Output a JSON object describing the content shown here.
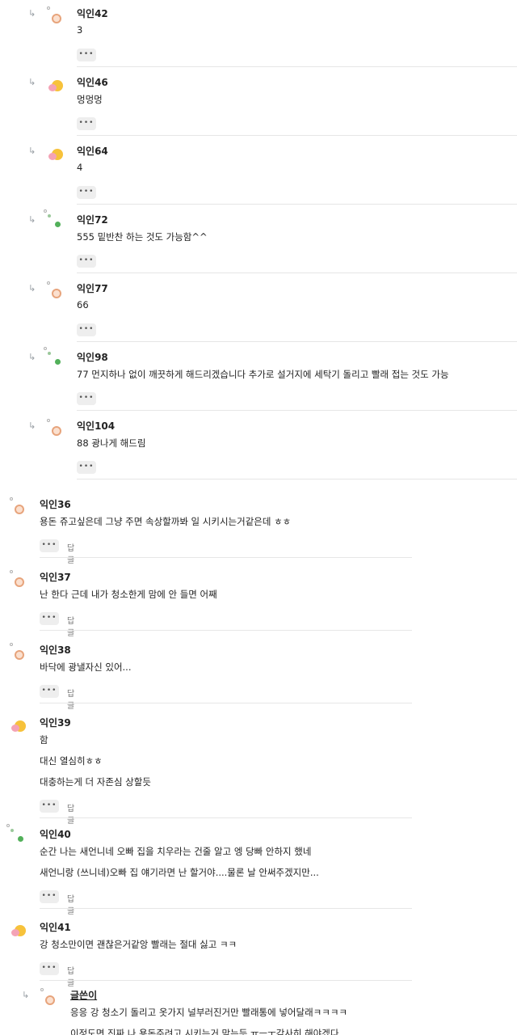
{
  "ui": {
    "more_label": "•••",
    "reply_label": "답글",
    "reply_arrow": "↳"
  },
  "comments": [
    {
      "kind": "reply",
      "avatar": "orange-ring-avatar",
      "name": "익인42",
      "lines": [
        "3"
      ],
      "has_reply_btn": false
    },
    {
      "kind": "reply",
      "avatar": "yellow-pink-avatar",
      "name": "익인46",
      "lines": [
        "멍멍멍"
      ],
      "has_reply_btn": false
    },
    {
      "kind": "reply",
      "avatar": "yellow-pink-avatar",
      "name": "익인64",
      "lines": [
        "4"
      ],
      "has_reply_btn": false
    },
    {
      "kind": "reply",
      "avatar": "green-dots-avatar",
      "name": "익인72",
      "lines": [
        "555 밑반찬 하는 것도 가능함^^"
      ],
      "has_reply_btn": false
    },
    {
      "kind": "reply",
      "avatar": "orange-ring-avatar",
      "name": "익인77",
      "lines": [
        "66"
      ],
      "has_reply_btn": false
    },
    {
      "kind": "reply",
      "avatar": "green-dots-avatar",
      "name": "익인98",
      "lines": [
        "77 먼지하나 없이 깨끗하게 해드리겠습니다 추가로 설거지에 세탁기 돌리고 빨래 접는 것도 가능"
      ],
      "has_reply_btn": false
    },
    {
      "kind": "reply",
      "avatar": "orange-ring-avatar",
      "name": "익인104",
      "lines": [
        "88 광나게 해드림"
      ],
      "has_reply_btn": false
    },
    {
      "kind": "top",
      "avatar": "orange-ring-avatar",
      "name": "익인36",
      "lines": [
        "용돈 쥬고싶은데 그냥 주면 속상할까봐 일 시키시는거같은데 ㅎㅎ"
      ],
      "has_reply_btn": true
    },
    {
      "kind": "top",
      "avatar": "orange-ring-avatar",
      "name": "익인37",
      "lines": [
        "난 한다 근데 내가 청소한게 맘에 안 들면 어째"
      ],
      "has_reply_btn": true
    },
    {
      "kind": "top",
      "avatar": "orange-ring-avatar",
      "name": "익인38",
      "lines": [
        "바닥에 광낼자신 있어..."
      ],
      "has_reply_btn": true
    },
    {
      "kind": "top",
      "avatar": "yellow-pink-avatar",
      "name": "익인39",
      "lines": [
        "함",
        "대신 열심히ㅎㅎ",
        "대충하는게 더 자존심 상할듯"
      ],
      "has_reply_btn": true
    },
    {
      "kind": "top",
      "avatar": "green-dots-avatar",
      "name": "익인40",
      "lines": [
        "순간 나는 새언니네 오빠 집을 치우라는 건줄 알고 엥 당빠 안하지 했네",
        "새언니랑 (쓰니네)오빠 집 얘기라면 난 할거야....물론 날 안써주겠지만..."
      ],
      "has_reply_btn": true
    },
    {
      "kind": "top",
      "avatar": "yellow-pink-avatar",
      "name": "익인41",
      "lines": [
        "강 청소만이면 괜찮은거같앙 빨래는 절대 싫고 ㅋㅋ"
      ],
      "has_reply_btn": true
    },
    {
      "kind": "reply-author",
      "avatar": "orange-ring-avatar",
      "name": "글쓴이",
      "lines": [
        "응응 강 청소기 돌리고 옷가지 널부러진거만 빨래통에 넣어달래ㅋㅋㅋㅋ",
        "이정도면 진짜 나 용돈주려고 시키는거 맞는듯 ㅠㅡㅜ감사히 해야겠다"
      ],
      "has_reply_btn": false
    }
  ]
}
